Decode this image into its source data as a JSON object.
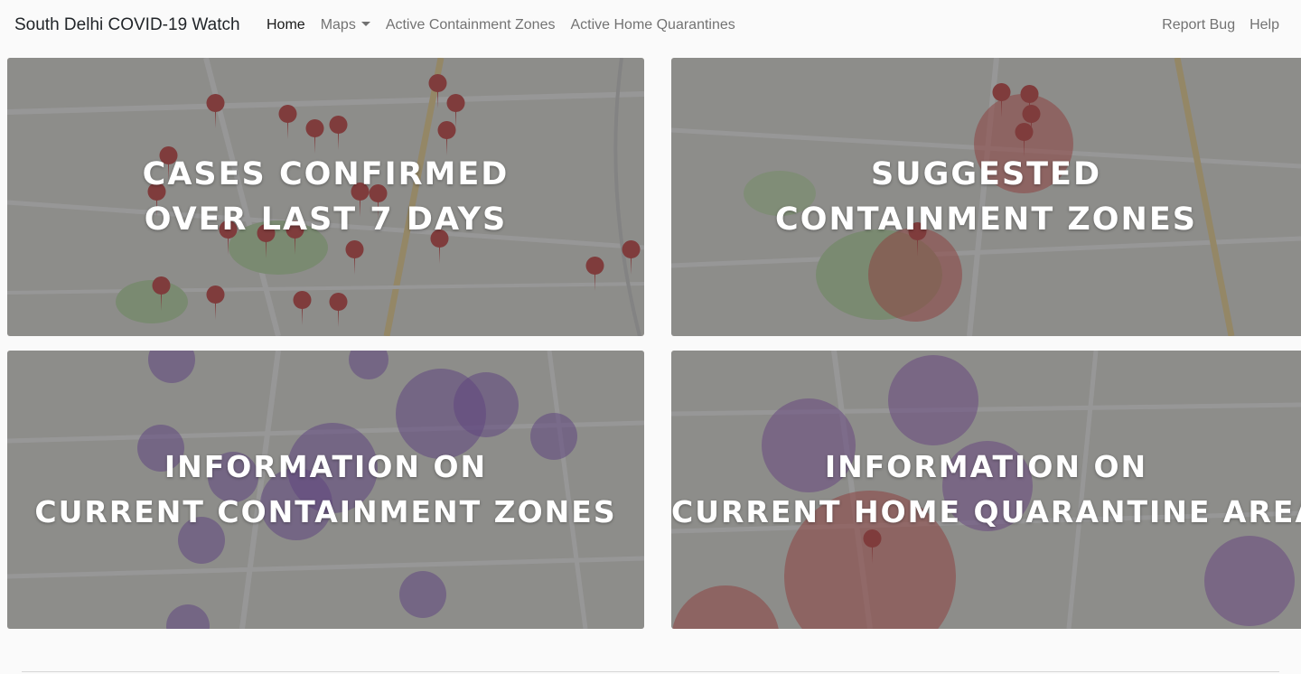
{
  "navbar": {
    "brand": "South Delhi COVID-19 Watch",
    "items": [
      {
        "label": "Home",
        "active": true
      },
      {
        "label": "Maps",
        "dropdown": true
      },
      {
        "label": "Active Containment Zones"
      },
      {
        "label": "Active Home Quarantines"
      }
    ],
    "right_items": [
      {
        "label": "Report Bug"
      },
      {
        "label": "Help"
      }
    ]
  },
  "tiles": [
    {
      "line1": "CASES CONFIRMED",
      "line2": "OVER LAST 7 DAYS",
      "marker_color": "#c62828"
    },
    {
      "line1": "SUGGESTED",
      "line2": "CONTAINMENT ZONES",
      "circle_color": "#e53935"
    },
    {
      "line1": "INFORMATION ON",
      "line2": "CURRENT CONTAINMENT ZONES",
      "circle_color": "#7b3fc4"
    },
    {
      "line1": "INFORMATION ON",
      "line2": "CURRENT HOME QUARANTINE AREAS",
      "circle_color": "#8e44c7"
    }
  ],
  "colors": {
    "nav_bg": "#fafafa",
    "overlay": "rgba(75,75,75,0.58)",
    "map_bg": "#e8e6e1",
    "park": "#b9dfa4",
    "road": "#ffffff",
    "main_road": "#f7d98b"
  }
}
